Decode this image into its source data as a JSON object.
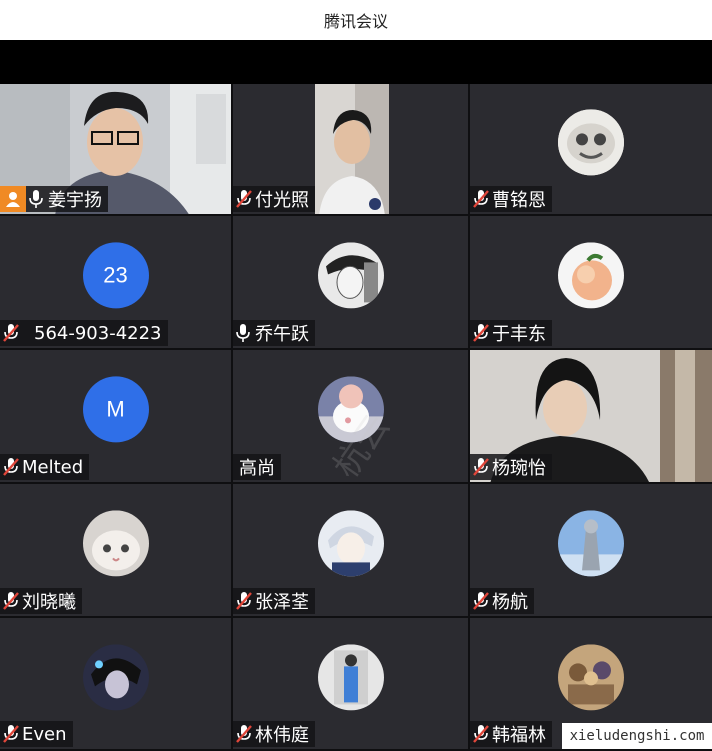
{
  "window": {
    "title": "腾讯会议"
  },
  "participants": [
    {
      "name": "姜宇扬",
      "mic": "on",
      "host": true,
      "kind": "video-man"
    },
    {
      "name": "付光照",
      "mic": "muted",
      "kind": "video-student"
    },
    {
      "name": "曹铭恩",
      "mic": "muted",
      "kind": "avatar-cartoon-face"
    },
    {
      "name": "564-903-4223",
      "mic": "muted",
      "kind": "letter",
      "letter": "23"
    },
    {
      "name": "乔午跃",
      "mic": "on",
      "kind": "avatar-sketch-portrait"
    },
    {
      "name": "于丰东",
      "mic": "muted",
      "kind": "avatar-peach"
    },
    {
      "name": "Melted",
      "mic": "muted",
      "kind": "letter",
      "letter": "M"
    },
    {
      "name": "高尚",
      "mic": "none",
      "kind": "avatar-anime-diaper"
    },
    {
      "name": "杨琬怡",
      "mic": "muted",
      "kind": "video-girl"
    },
    {
      "name": "刘晓曦",
      "mic": "muted",
      "kind": "avatar-cat"
    },
    {
      "name": "张泽荃",
      "mic": "muted",
      "kind": "avatar-anime-boy"
    },
    {
      "name": "杨航",
      "mic": "muted",
      "kind": "avatar-sky-statue"
    },
    {
      "name": "Even",
      "mic": "muted",
      "kind": "avatar-dark-anime"
    },
    {
      "name": "林伟庭",
      "mic": "muted",
      "kind": "avatar-blue-figure"
    },
    {
      "name": "韩福林",
      "mic": "muted",
      "kind": "avatar-group-art"
    }
  ],
  "watermark": {
    "text": "xieludengshi.com",
    "center_text": "杭云"
  },
  "colors": {
    "accent_blue": "#2f6fe8",
    "host_orange": "#f08a24",
    "mute_red": "#e0463a"
  }
}
